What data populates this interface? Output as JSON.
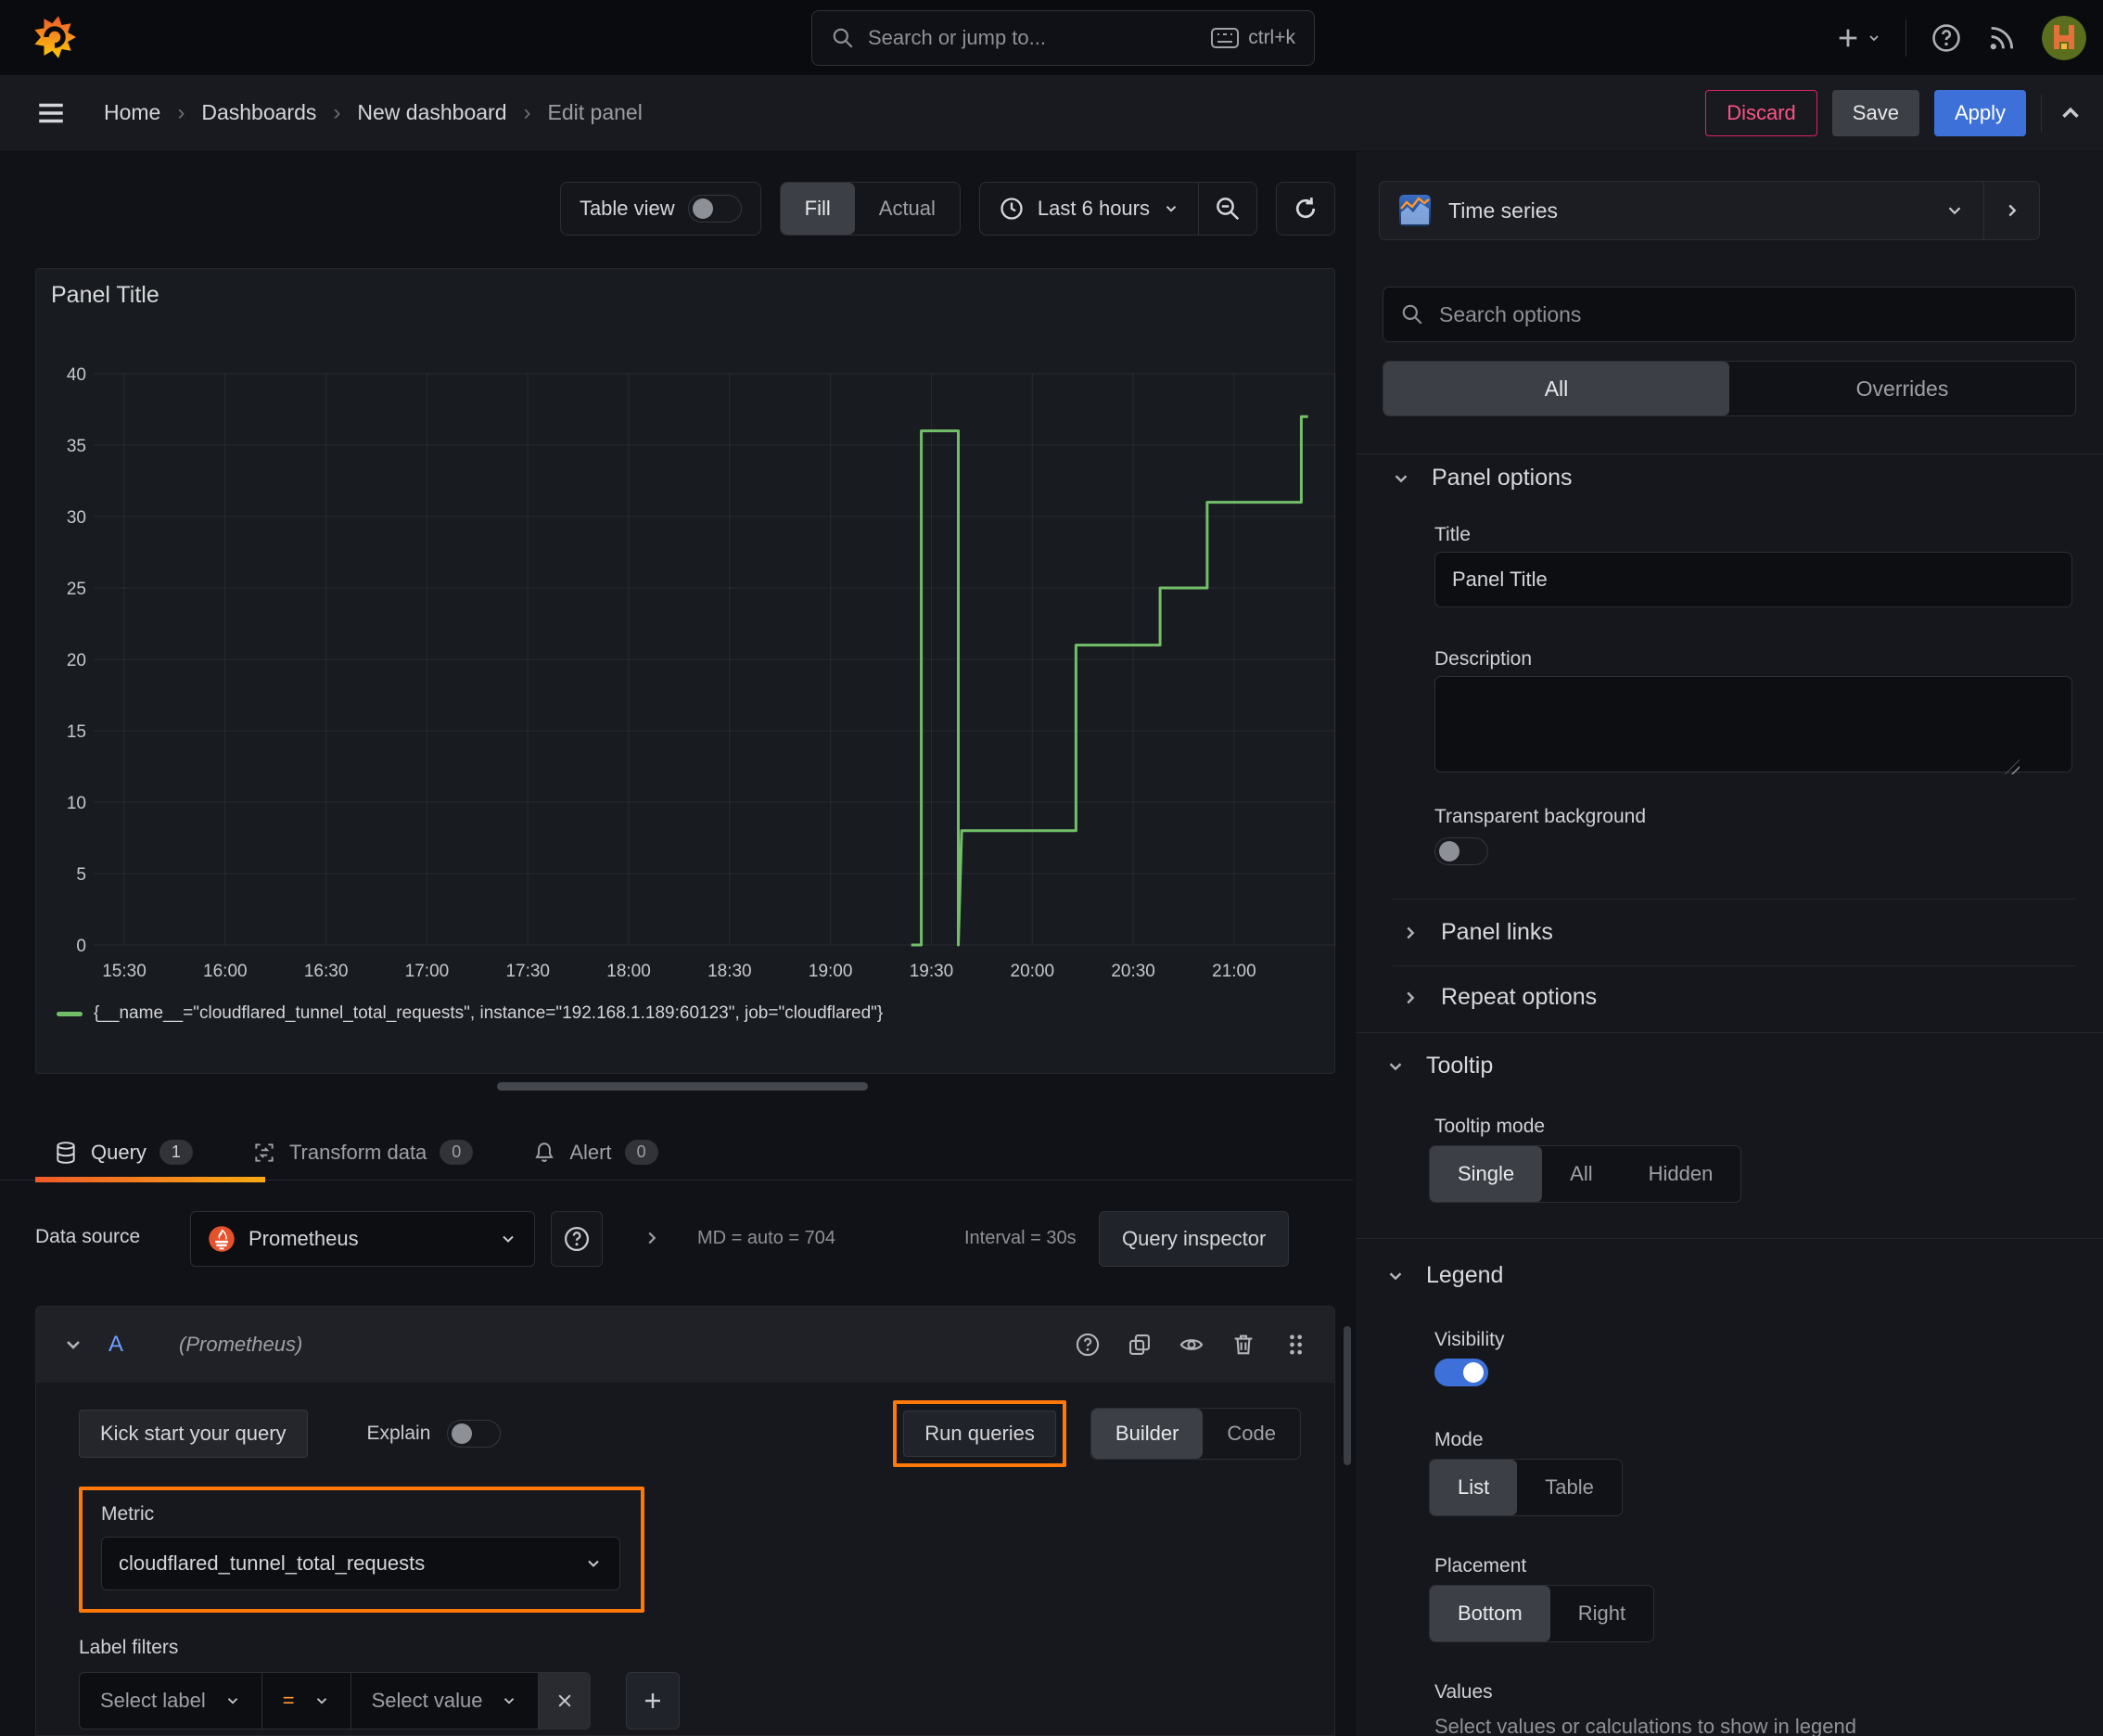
{
  "chrome": {
    "search_placeholder": "Search or jump to...",
    "search_shortcut": "ctrl+k",
    "breadcrumb": [
      "Home",
      "Dashboards",
      "New dashboard",
      "Edit panel"
    ],
    "breadcrumb_sep": "›",
    "discard": "Discard",
    "save": "Save",
    "apply": "Apply"
  },
  "toolbar": {
    "table_view": "Table view",
    "fill": "Fill",
    "actual": "Actual",
    "time_range": "Last 6 hours"
  },
  "panel": {
    "title": "Panel Title"
  },
  "chart_data": {
    "type": "line",
    "title": "Panel Title",
    "x_tick_labels": [
      "15:30",
      "16:00",
      "16:30",
      "17:00",
      "17:30",
      "18:00",
      "18:30",
      "19:00",
      "19:30",
      "20:00",
      "20:30",
      "21:00"
    ],
    "x_tick_minutes": [
      0,
      30,
      60,
      90,
      120,
      150,
      180,
      210,
      240,
      270,
      300,
      330,
      360
    ],
    "x_axis_start": "15:21",
    "x_axis_end": "21:30",
    "y_ticks": [
      0,
      5,
      10,
      15,
      20,
      25,
      30,
      35,
      40
    ],
    "ylim": [
      0,
      40
    ],
    "grid": true,
    "legend_position": "bottom",
    "series": [
      {
        "name": "{__name__=\"cloudflared_tunnel_total_requests\", instance=\"192.168.1.189:60123\", job=\"cloudflared\"}",
        "color": "#73bf69",
        "step_points": [
          [
            234,
            0
          ],
          [
            237,
            0
          ],
          [
            237,
            36
          ],
          [
            248,
            36
          ],
          [
            248,
            0
          ],
          [
            249,
            8
          ],
          [
            283,
            8
          ],
          [
            283,
            21
          ],
          [
            308,
            21
          ],
          [
            308,
            25
          ],
          [
            322,
            25
          ],
          [
            322,
            31
          ],
          [
            350,
            31
          ],
          [
            350,
            37
          ],
          [
            352,
            37
          ]
        ]
      }
    ]
  },
  "tabs": {
    "query": "Query",
    "query_count": "1",
    "transform": "Transform data",
    "transform_count": "0",
    "alert": "Alert",
    "alert_count": "0"
  },
  "query": {
    "datasource_label": "Data source",
    "datasource": "Prometheus",
    "md_stat": "MD = auto = 704",
    "interval_stat": "Interval = 30s",
    "inspector": "Query inspector",
    "row_letter": "A",
    "row_ds": "(Prometheus)",
    "kick_start": "Kick start your query",
    "explain": "Explain",
    "run_queries": "Run queries",
    "builder": "Builder",
    "code": "Code",
    "metric_label": "Metric",
    "metric_value": "cloudflared_tunnel_total_requests",
    "label_filters_label": "Label filters",
    "select_label": "Select label",
    "operator": "=",
    "select_value": "Select value"
  },
  "options": {
    "visualization": "Time series",
    "search_placeholder": "Search options",
    "tab_all": "All",
    "tab_overrides": "Overrides",
    "panel_options": "Panel options",
    "title_label": "Title",
    "title_value": "Panel Title",
    "description_label": "Description",
    "transparent_label": "Transparent background",
    "panel_links": "Panel links",
    "repeat_options": "Repeat options",
    "tooltip": "Tooltip",
    "tooltip_mode": "Tooltip mode",
    "mode_single": "Single",
    "mode_all": "All",
    "mode_hidden": "Hidden",
    "legend": "Legend",
    "visibility": "Visibility",
    "mode": "Mode",
    "mode_list": "List",
    "mode_table": "Table",
    "placement": "Placement",
    "placement_bottom": "Bottom",
    "placement_right": "Right",
    "values_label": "Values",
    "values_help": "Select values or calculations to show in legend"
  },
  "colors": {
    "accent_blue": "#3d71d9",
    "series_green": "#73bf69",
    "annotation_orange": "#ff780a",
    "discard_pink": "#e0226e"
  }
}
